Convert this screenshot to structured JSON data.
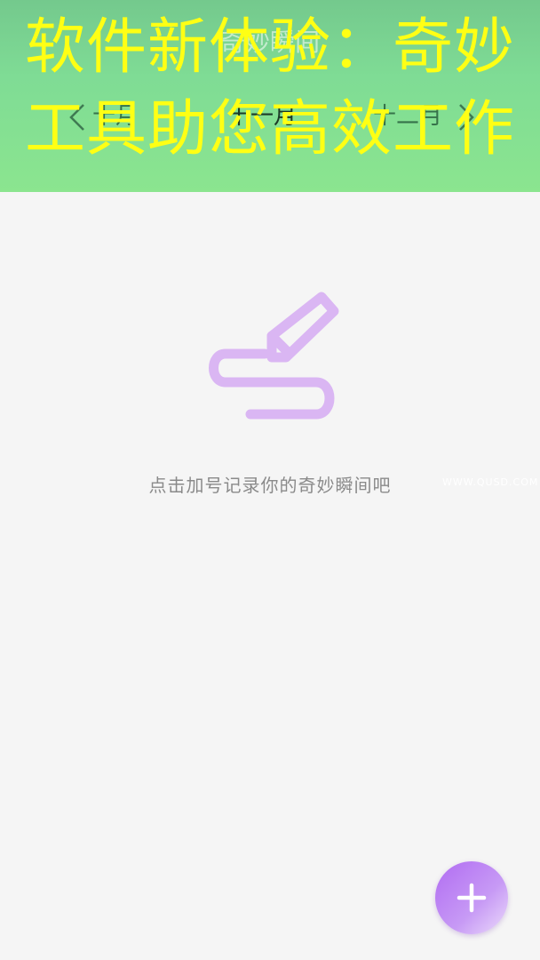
{
  "header": {
    "title": "奇妙瞬间",
    "months": {
      "prev": "十月",
      "current": "十一月",
      "next": "十二月"
    }
  },
  "overlay": {
    "line1": "软件新体验：奇妙",
    "line2": "工具助您高效工作"
  },
  "empty_state": {
    "message": "点击加号记录你的奇妙瞬间吧",
    "icon": "pen-scribble-icon"
  },
  "watermark": "WWW.QUSD.COM",
  "fab": {
    "icon": "plus-icon"
  },
  "colors": {
    "header_green": "#7fdc95",
    "accent_purple": "#b16cf2",
    "overlay_yellow": "#ffff14",
    "background": "#f5f5f5"
  }
}
